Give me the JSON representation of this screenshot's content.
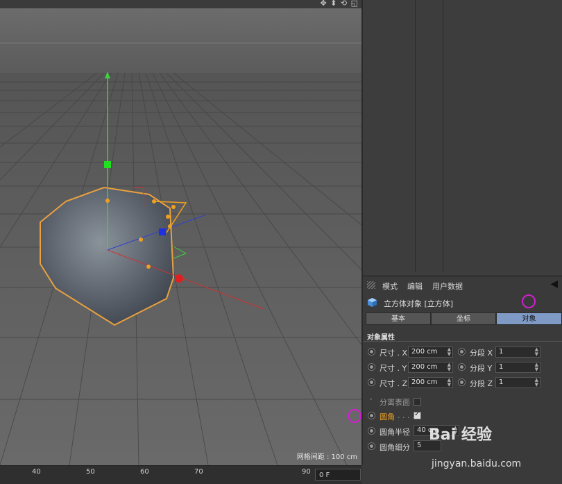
{
  "viewport": {
    "grid_spacing": "网格间距 : 100 cm"
  },
  "timeline": {
    "ticks": [
      "40",
      "50",
      "60",
      "70",
      "90"
    ],
    "frame": "0 F"
  },
  "attributes": {
    "menu": [
      "模式",
      "编辑",
      "用户数据"
    ],
    "object_title": "立方体对象 [立方体]",
    "tabs": [
      "基本",
      "坐标",
      "对象"
    ],
    "active_tab": "对象",
    "section": "对象属性",
    "size_x_label": "尺寸 . X",
    "size_x": "200 cm",
    "size_y_label": "尺寸 . Y",
    "size_y": "200 cm",
    "size_z_label": "尺寸 . Z",
    "size_z": "200 cm",
    "seg_x_label": "分段 X",
    "seg_x": "1",
    "seg_y_label": "分段 Y",
    "seg_y": "1",
    "seg_z_label": "分段 Z",
    "seg_z": "1",
    "separate_surfaces": "分离表面",
    "fillet": "圆角",
    "fillet_dots": ". . . .",
    "fillet_radius_label": "圆角半径",
    "fillet_radius": "40 cm",
    "fillet_subdiv_label": "圆角细分",
    "fillet_subdiv": "5"
  },
  "watermark": {
    "brand": "Bai 经验",
    "url": "jingyan.baidu.com"
  },
  "colors": {
    "active_tab": "#7f9ac4",
    "highlight": "#f0a020",
    "marker": "#d020d0"
  }
}
